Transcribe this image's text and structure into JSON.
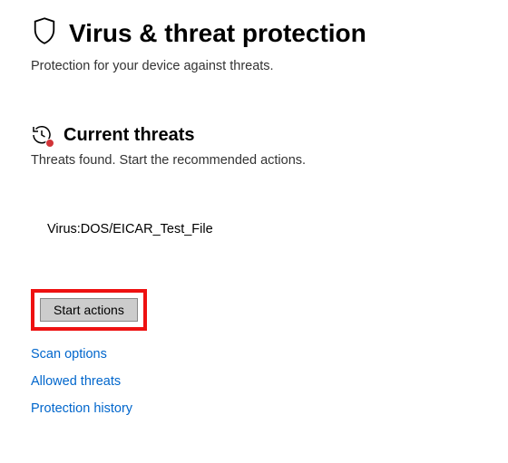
{
  "header": {
    "title": "Virus & threat protection",
    "subtitle": "Protection for your device against threats."
  },
  "section": {
    "title": "Current threats",
    "subtitle": "Threats found. Start the recommended actions."
  },
  "threats": [
    {
      "name": "Virus:DOS/EICAR_Test_File"
    }
  ],
  "actions": {
    "start_label": "Start actions"
  },
  "links": {
    "scan_options": "Scan options",
    "allowed_threats": "Allowed threats",
    "protection_history": "Protection history"
  }
}
